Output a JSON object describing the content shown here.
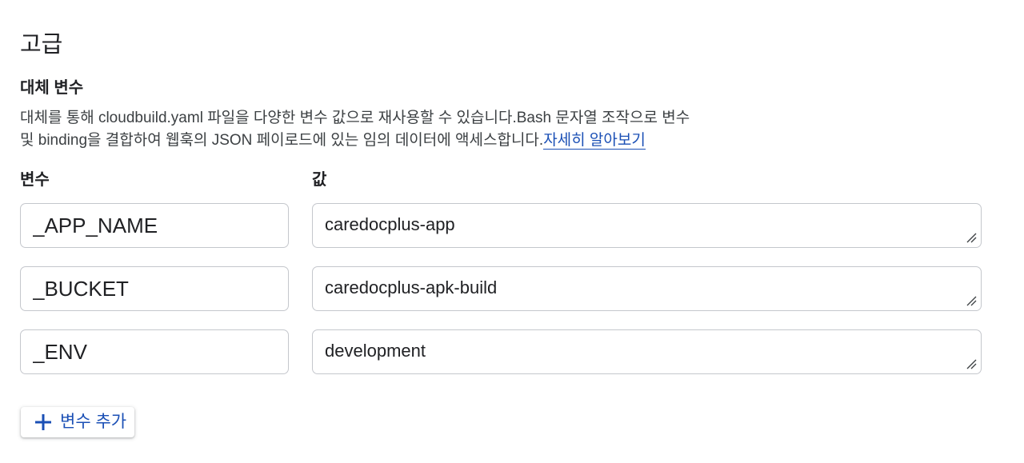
{
  "section": {
    "title": "고급"
  },
  "substitutions": {
    "title": "대체 변수",
    "description_line1": "대체를 통해 cloudbuild.yaml 파일을 다양한 변수 값으로 재사용할 수 있습니다.Bash 문자열 조작으로 변수",
    "description_line2": "및 binding을 결합하여 웹훅의 JSON 페이로드에 있는 임의 데이터에 액세스합니다.",
    "learn_more": "자세히 알아보기",
    "variable_header": "변수",
    "value_header": "값",
    "rows": [
      {
        "variable": "_APP_NAME",
        "value": "caredocplus-app"
      },
      {
        "variable": "_BUCKET",
        "value": "caredocplus-apk-build"
      },
      {
        "variable": "_ENV",
        "value": "development"
      }
    ],
    "add_button_label": "변수 추가",
    "add_icon": "plus-icon"
  },
  "colors": {
    "accent": "#1a4fb5",
    "border": "#c4c7cc",
    "text": "#202124"
  }
}
